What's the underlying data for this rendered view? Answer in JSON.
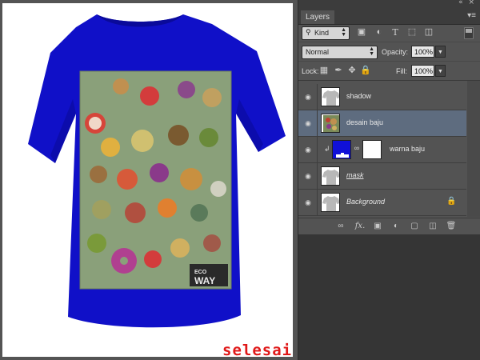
{
  "canvas": {
    "watermark": "selesai",
    "shirt_color": "#1010c8",
    "shirt_shadow": "#0a0a9a",
    "print_frame_color": "#8aa07a",
    "print_badge_lines": [
      "ECO",
      "WAY"
    ]
  },
  "panel": {
    "tab_label": "Layers",
    "topbar_controls": "« ×",
    "menu_icon": "panel-menu-icon",
    "filter": {
      "kind_label": "Kind",
      "icons": [
        "image-filter-icon",
        "adjustment-filter-icon",
        "type-filter-icon",
        "shape-filter-icon",
        "smart-object-filter-icon"
      ]
    },
    "blend_mode": "Normal",
    "opacity_label": "Opacity:",
    "opacity_value": "100%",
    "lock_label": "Lock:",
    "fill_label": "Fill:",
    "fill_value": "100%",
    "lock_icons": [
      "lock-transparent-icon",
      "lock-image-icon",
      "lock-position-icon",
      "lock-all-icon"
    ],
    "layers": [
      {
        "name": "shadow",
        "visible": true,
        "selected": false,
        "thumb": "tshirt"
      },
      {
        "name": "desain baju",
        "visible": true,
        "selected": true,
        "thumb": "design"
      },
      {
        "name": "warna baju",
        "visible": true,
        "selected": false,
        "thumb": "color-fill",
        "fill_color": "#1010d8",
        "clipped": true
      },
      {
        "name": "mask",
        "visible": true,
        "selected": false,
        "thumb": "tshirt"
      },
      {
        "name": "Background",
        "visible": true,
        "selected": false,
        "thumb": "tshirt",
        "locked": true
      }
    ],
    "bottom_icons": [
      "link-layers-icon",
      "fx-icon",
      "add-mask-icon",
      "adjustment-layer-icon",
      "new-group-icon",
      "new-layer-icon",
      "delete-layer-icon"
    ],
    "bottom_fx_label": "fx."
  }
}
